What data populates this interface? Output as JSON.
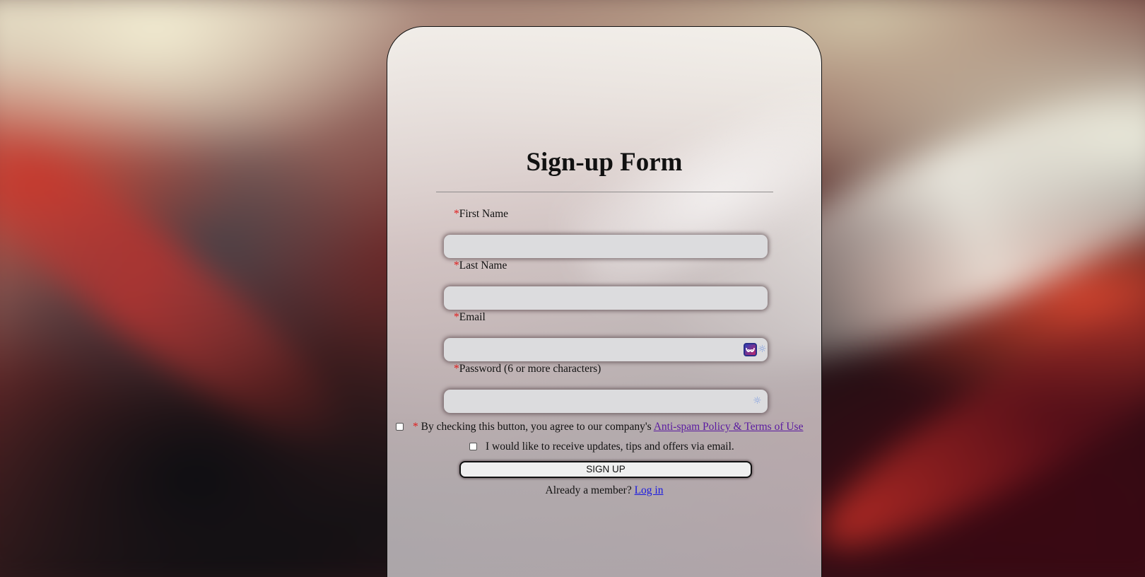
{
  "form": {
    "title": "Sign-up Form",
    "required_marker": "*",
    "fields": [
      {
        "label": "First Name",
        "value": "",
        "placeholder": ""
      },
      {
        "label": "Last Name",
        "value": "",
        "placeholder": ""
      },
      {
        "label": "Email",
        "value": "",
        "placeholder": ""
      },
      {
        "label": "Password (6 or more characters)",
        "value": "",
        "placeholder": ""
      }
    ],
    "terms": {
      "checked": false,
      "text": "By checking this button, you agree to our company's",
      "link_text": "Anti-spam Policy & Terms of Use"
    },
    "updates": {
      "checked": false,
      "text": "I would like to receive updates, tips and offers via email."
    },
    "submit_label": "SIGN UP",
    "login_prompt": "Already a member?",
    "login_link": "Log in"
  },
  "icons": {
    "email_extension": "bitwarden-icon",
    "email_sparkle": "sparkle-icon",
    "password_sparkle": "sparkle-icon"
  },
  "colors": {
    "required": "#e01b1b",
    "visited_link": "#5a1aa0",
    "link": "#1a1ae0"
  }
}
